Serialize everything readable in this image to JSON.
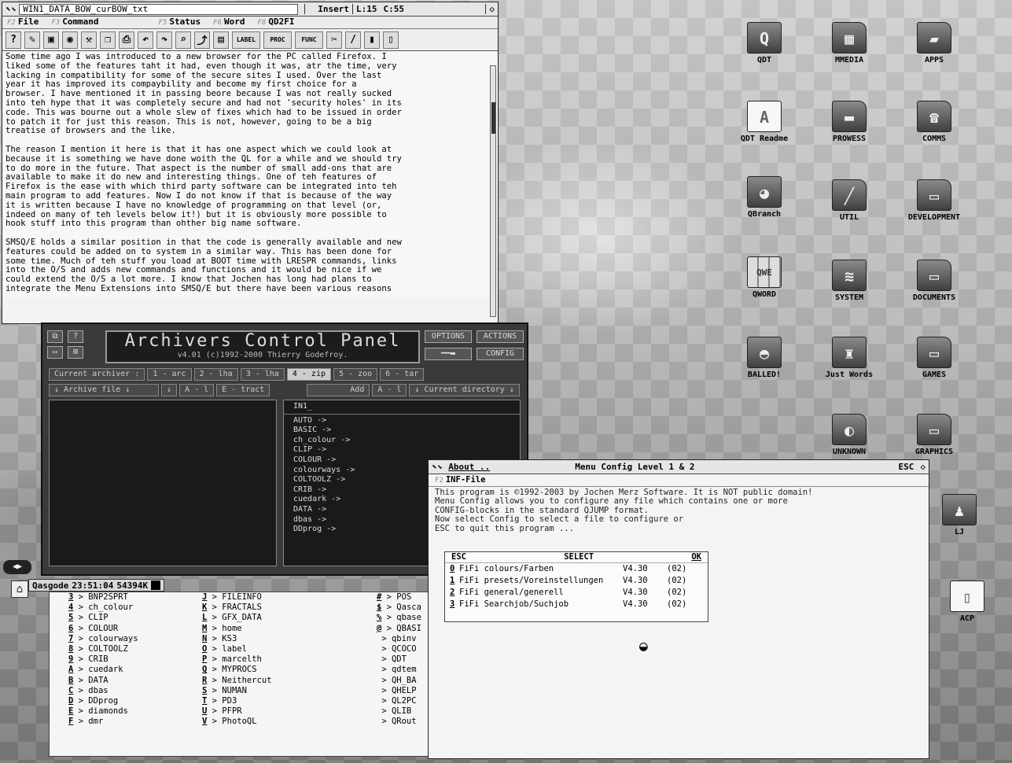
{
  "editor": {
    "filename": "WIN1_DATA_BOW_curBOW_txt",
    "mode": "Insert",
    "line": "L:15",
    "col": "C:55",
    "menus": [
      "File",
      "Command",
      "Status",
      "Word",
      "QD2FI"
    ],
    "menu_keys": [
      "F2",
      "F3",
      "F5",
      "F6",
      "F8"
    ],
    "toolbar_icons": [
      "help-icon",
      "pencil-icon",
      "save-icon",
      "disk-icon",
      "tools-icon",
      "copy-icon",
      "print-icon",
      "undo-icon",
      "redo-icon",
      "find-icon",
      "jump-icon",
      "block-icon",
      "label-icon",
      "proc-icon",
      "func-icon",
      "cut-icon",
      "pen-icon",
      "scroll-icon",
      "scroll2-icon"
    ],
    "toolbar_labels": [
      "?",
      "✎",
      "▣",
      "◉",
      "⚒",
      "❐",
      "⎙",
      "↶",
      "↷",
      "⌕",
      "⤴",
      "▤",
      "LABEL",
      "PROC",
      "FUNC",
      "✂",
      "/",
      "▮",
      "▯"
    ],
    "text": "Some time ago I was introduced to a new browser for the PC called Firefox. I\nliked some of the features taht it had, even though it was, atr the time, very\nlacking in compatibility for some of the secure sites I used. Over the last\nyear it has improved its compaybility and become my first choice for a\nbrowser. I have mentioned it in passing beore because I was not really sucked\ninto teh hype that it was completely secure and had not 'security holes' in its\ncode. This was bourne out a whole slew of fixes which had to be issued in order\nto patch it for just this reason. This is not, however, going to be a big\ntreatise of browsers and the like.\n\nThe reason I mention it here is that it has one aspect which we could look at\nbecause it is something we have done woith the QL for a while and we should try\nto do more in the future. That aspect is the number of small add-ons that are\navailable to make it do new and interesting things. One of teh features of\nFirefox is the ease with which third party software can be integrated into teh\nmain program to add features. Now I do not know if that is because of the way\nit is written because I have no knowledge of programming on that level (or,\nindeed on many of teh levels below it!) but it is obviously more possible to\nhook stuff into this program than ohther big name software.\n\nSMSQ/E holds a similar position in that the code is generally available and new\nfeatures could be added on to system in a similar way. This has been done for\nsome time. Much of teh stuff you load at BOOT time with LRESPR commands, links\ninto the O/S and adds new commands and functions and it would be nice if we\ncould extend the O/S a lot more. I know that Jochen has long had plans to\nintegrate the Menu Extensions into SMSQ/E but there have been various reasons"
  },
  "archiver": {
    "title": "Archivers Control Panel",
    "subtitle": "v4.01 (c)1992-2000 Thierry Godefroy.",
    "buttons_right": [
      "OPTIONS",
      "ACTIONS",
      "CONFIG"
    ],
    "current_archiver_label": "Current archiver :",
    "archivers": [
      "1 - arc",
      "2 - lha",
      "3 - lha",
      "4 - zip",
      "5 - zoo",
      "6 - tar"
    ],
    "archive_file_label": "↓ Archive file ↓",
    "extract_label": "E - tract",
    "add_label": "Add",
    "all_label": "A - l",
    "current_dir_label": "↓ Current directory ↓",
    "dir_path": "IN1_",
    "dir_items": [
      "AUTO ->",
      "BASIC ->",
      "ch_colour ->",
      "CLIP ->",
      "COLOUR ->",
      "colourways ->",
      "COLTOOLZ ->",
      "CRIB ->",
      "cuedark ->",
      "DATA ->",
      "dbas ->",
      "DDprog ->"
    ]
  },
  "status": {
    "name": "Qasgode",
    "time": "23:51:04",
    "memory": "54394K"
  },
  "files": {
    "col1": [
      {
        "k": "3",
        "n": "BNP2SPRT"
      },
      {
        "k": "4",
        "n": "ch_colour"
      },
      {
        "k": "5",
        "n": "CLIP"
      },
      {
        "k": "6",
        "n": "COLOUR"
      },
      {
        "k": "7",
        "n": "colourways"
      },
      {
        "k": "8",
        "n": "COLTOOLZ"
      },
      {
        "k": "9",
        "n": "CRIB"
      },
      {
        "k": "A",
        "n": "cuedark"
      },
      {
        "k": "B",
        "n": "DATA"
      },
      {
        "k": "C",
        "n": "dbas"
      },
      {
        "k": "D",
        "n": "DDprog"
      },
      {
        "k": "E",
        "n": "diamonds"
      },
      {
        "k": "F",
        "n": "dmr"
      }
    ],
    "col2": [
      {
        "k": "J",
        "n": "FILEINFO"
      },
      {
        "k": "K",
        "n": "FRACTALS"
      },
      {
        "k": "L",
        "n": "GFX_DATA"
      },
      {
        "k": "M",
        "n": "home"
      },
      {
        "k": "N",
        "n": "KS3"
      },
      {
        "k": "O",
        "n": "label"
      },
      {
        "k": "P",
        "n": "marcelth"
      },
      {
        "k": "Q",
        "n": "MYPROCS"
      },
      {
        "k": "R",
        "n": "Neithercut"
      },
      {
        "k": "S",
        "n": "NUMAN"
      },
      {
        "k": "T",
        "n": "PD3"
      },
      {
        "k": "U",
        "n": "PFPR"
      },
      {
        "k": "V",
        "n": "PhotoQL"
      }
    ],
    "col3": [
      {
        "k": "#",
        "n": "POS"
      },
      {
        "k": "$",
        "n": "Qasca"
      },
      {
        "k": "%",
        "n": "qbase"
      },
      {
        "k": "@",
        "n": "QBASI"
      },
      {
        "k": "",
        "n": "qbinv"
      },
      {
        "k": "",
        "n": "QCOCO"
      },
      {
        "k": "",
        "n": "QDT"
      },
      {
        "k": "",
        "n": "qdtem"
      },
      {
        "k": "",
        "n": "QH_BA"
      },
      {
        "k": "",
        "n": "QHELP"
      },
      {
        "k": "",
        "n": "QL2PC"
      },
      {
        "k": "",
        "n": "QLIB"
      },
      {
        "k": "",
        "n": "QRout"
      }
    ]
  },
  "about": {
    "title_left": "About ..",
    "title_center": "Menu Config Level 1 & 2",
    "esc": "ESC",
    "tab": "INF-File",
    "message": "This program is ©1992-2003 by Jochen Merz Software. It is NOT public domain!\nMenu Config allows you to configure any file which contains one or more\nCONFIG-blocks in the standard QJUMP format.\nNow select Config to select a file to configure or\nESC to quit this program ...",
    "select_header": {
      "esc": "ESC",
      "select": "SELECT",
      "ok": "OK"
    },
    "rows": [
      {
        "n": "0",
        "f": "FiFi colours/Farben",
        "v": "V4.30",
        "c": "(02)"
      },
      {
        "n": "1",
        "f": "FiFi presets/Voreinstellungen",
        "v": "V4.30",
        "c": "(02)"
      },
      {
        "n": "2",
        "f": "FiFi general/generell",
        "v": "V4.30",
        "c": "(02)"
      },
      {
        "n": "3",
        "f": "FiFi Searchjob/Suchjob",
        "v": "V4.30",
        "c": "(02)"
      }
    ]
  },
  "desktop": {
    "icons": [
      {
        "label": "QDT",
        "glyph": "Q"
      },
      {
        "label": "MMEDIA",
        "glyph": "▦"
      },
      {
        "label": "APPS",
        "glyph": "▰"
      },
      {
        "label": "QDT Readme",
        "glyph": "A"
      },
      {
        "label": "PROWESS",
        "glyph": "▬"
      },
      {
        "label": "COMMS",
        "glyph": "☎"
      },
      {
        "label": "QBranch",
        "glyph": "◕"
      },
      {
        "label": "UTIL",
        "glyph": "╱"
      },
      {
        "label": "DEVELOPMENT",
        "glyph": "▭"
      },
      {
        "label": "QWORD",
        "glyph": "QWE"
      },
      {
        "label": "SYSTEM",
        "glyph": "≋"
      },
      {
        "label": "DOCUMENTS",
        "glyph": "▭"
      },
      {
        "label": "BALLED!",
        "glyph": "◓"
      },
      {
        "label": "Just Words",
        "glyph": "♜"
      },
      {
        "label": "GAMES",
        "glyph": "▭"
      },
      {
        "label": "UNKNOWN",
        "glyph": "◐"
      },
      {
        "label": "GRAPHICS",
        "glyph": "▭"
      },
      {
        "label": "LJ",
        "glyph": "♟"
      },
      {
        "label": "ACP",
        "glyph": "▯"
      }
    ]
  }
}
